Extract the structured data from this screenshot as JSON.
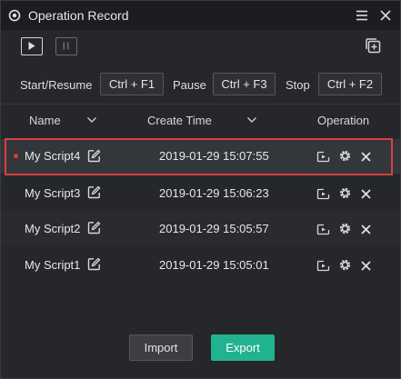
{
  "window": {
    "title": "Operation Record"
  },
  "toolbar": {
    "play_icon": "play-icon",
    "pause_icon": "pause-icon",
    "new_icon": "new-record-icon"
  },
  "shortcuts": [
    {
      "label": "Start/Resume",
      "key": "Ctrl + F1"
    },
    {
      "label": "Pause",
      "key": "Ctrl + F3"
    },
    {
      "label": "Stop",
      "key": "Ctrl + F2"
    }
  ],
  "table": {
    "headers": {
      "name": "Name",
      "create_time": "Create Time",
      "operation": "Operation"
    },
    "rows": [
      {
        "name": "My Script4",
        "time": "2019-01-29 15:07:55",
        "selected": true
      },
      {
        "name": "My Script3",
        "time": "2019-01-29 15:06:23",
        "selected": false
      },
      {
        "name": "My Script2",
        "time": "2019-01-29 15:05:57",
        "selected": false
      },
      {
        "name": "My Script1",
        "time": "2019-01-29 15:05:01",
        "selected": false
      }
    ]
  },
  "footer": {
    "import_label": "Import",
    "export_label": "Export"
  },
  "colors": {
    "accent": "#21b38f",
    "highlight_border": "#d94040",
    "record_dot": "#e53935",
    "background": "#25272b"
  }
}
